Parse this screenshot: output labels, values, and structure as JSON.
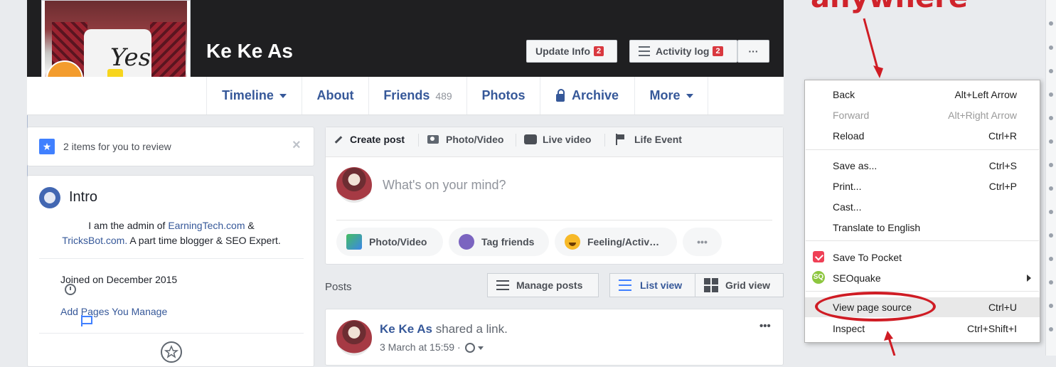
{
  "annotation": {
    "text": "anywhere",
    "color": "#d0232b"
  },
  "profile": {
    "name": "Ke Ke As",
    "avatar_shirt_text": "Yes"
  },
  "cover_buttons": {
    "update_info": {
      "label": "Update Info",
      "badge": "2"
    },
    "activity_log": {
      "label": "Activity log",
      "badge": "2"
    },
    "more": "···"
  },
  "nav": {
    "timeline": "Timeline",
    "about": "About",
    "friends": "Friends",
    "friends_count": "489",
    "photos": "Photos",
    "archive": "Archive",
    "more": "More"
  },
  "review": {
    "text": "2 items for you to review",
    "close": "×"
  },
  "intro": {
    "title": "Intro",
    "bio_part1": "I am the admin of ",
    "bio_link1": "EarningTech.com",
    "bio_part2": " &",
    "bio_link2": "TricksBot.com.",
    "bio_part3": " A part time blogger & SEO Expert.",
    "joined": "Joined on December 2015",
    "add_pages": "Add Pages You Manage"
  },
  "composer": {
    "tabs": [
      "Create post",
      "Photo/Video",
      "Live video",
      "Life Event"
    ],
    "placeholder": "What's on your mind?",
    "actions": [
      "Photo/Video",
      "Tag friends",
      "Feeling/Activ…"
    ],
    "more": "•••"
  },
  "posts_bar": {
    "label": "Posts",
    "manage": "Manage posts",
    "list_view": "List view",
    "grid_view": "Grid view"
  },
  "post": {
    "author": "Ke Ke As",
    "action": " shared a link.",
    "time": "3 March at 15:59 ·",
    "menu": "•••"
  },
  "context_menu": {
    "items": [
      {
        "label": "Back",
        "shortcut": "Alt+Left Arrow",
        "disabled": false
      },
      {
        "label": "Forward",
        "shortcut": "Alt+Right Arrow",
        "disabled": true
      },
      {
        "label": "Reload",
        "shortcut": "Ctrl+R",
        "disabled": false
      },
      {
        "label": "Save as...",
        "shortcut": "Ctrl+S",
        "disabled": false
      },
      {
        "label": "Print...",
        "shortcut": "Ctrl+P",
        "disabled": false
      },
      {
        "label": "Cast...",
        "shortcut": "",
        "disabled": false
      },
      {
        "label": "Translate to English",
        "shortcut": "",
        "disabled": false
      },
      {
        "label": "Save To Pocket",
        "shortcut": "",
        "disabled": false
      },
      {
        "label": "SEOquake",
        "shortcut": "",
        "disabled": false
      },
      {
        "label": "View page source",
        "shortcut": "Ctrl+U",
        "disabled": false
      },
      {
        "label": "Inspect",
        "shortcut": "Ctrl+Shift+I",
        "disabled": false
      }
    ]
  },
  "colors": {
    "fb_blue": "#365899",
    "badge_red": "#d9383f",
    "cover": "#1f1f21"
  }
}
